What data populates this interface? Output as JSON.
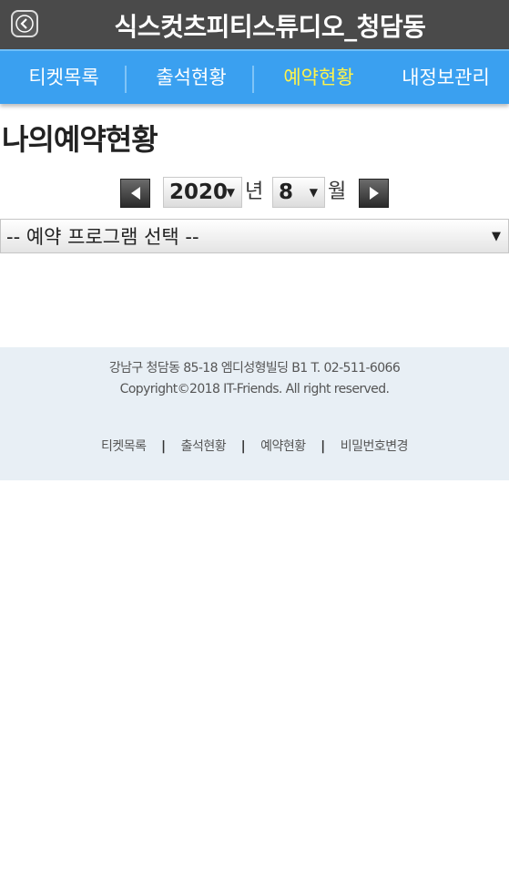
{
  "app": {
    "title": "식스컷츠피티스튜디오_청담동"
  },
  "nav": {
    "items": [
      {
        "label": "티켓목록",
        "active": false
      },
      {
        "label": "출석현황",
        "active": false
      },
      {
        "label": "예약현황",
        "active": true
      },
      {
        "label": "내정보관리",
        "active": false
      }
    ],
    "active_color": "#fff34a"
  },
  "page": {
    "title": "나의예약현황"
  },
  "month_selector": {
    "year": "2020",
    "year_unit": "년",
    "month": "8",
    "month_unit": "월"
  },
  "program_select": {
    "selected": "-- 예약 프로그램 선택 --"
  },
  "footer": {
    "address": "강남구 청담동 85-18 엠디성형빌딩 B1 T. 02-511-6066",
    "copyright": "Copyright©2018 IT-Friends. All right reserved.",
    "links": [
      "티켓목록",
      "출석현황",
      "예약현황",
      "비밀번호변경"
    ],
    "separator": "|"
  },
  "colors": {
    "titlebar": "#4a4a4a",
    "navbar": "#3aa0f0",
    "footer_bg": "#e8eff5"
  }
}
